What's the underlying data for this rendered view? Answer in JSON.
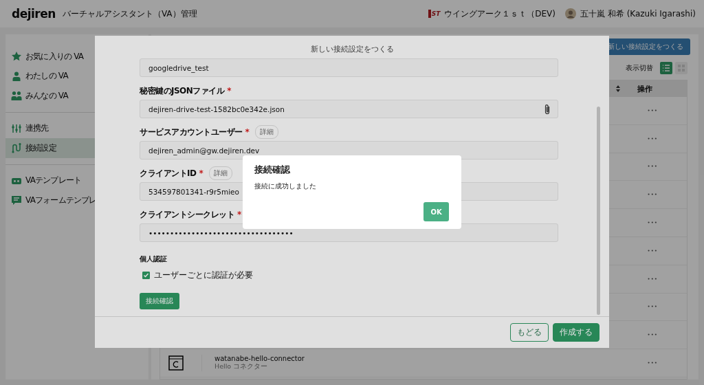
{
  "header": {
    "logo": "dejiren",
    "title": "バーチャルアシスタント（VA）管理",
    "org_logo": "ST",
    "org_name": "ウイングアーク１ｓｔ（DEV)",
    "user_name": "五十嵐 和希 (Kazuki Igarashi)"
  },
  "sidebar": {
    "groups": [
      {
        "items": [
          {
            "kind": "star",
            "label": "お気に入りの VA",
            "selected": false
          },
          {
            "kind": "person",
            "label": "わたしの VA",
            "selected": false
          },
          {
            "kind": "people",
            "label": "みんなの VA",
            "selected": false
          }
        ]
      },
      {
        "items": [
          {
            "kind": "sliders",
            "label": "連携先",
            "selected": false
          },
          {
            "kind": "route",
            "label": "接続設定",
            "selected": true
          }
        ]
      },
      {
        "items": [
          {
            "kind": "template",
            "label": "VAテンプレート",
            "selected": false
          },
          {
            "kind": "form",
            "label": "VAフォームテンプレ",
            "selected": false
          }
        ]
      }
    ]
  },
  "toolbar": {
    "new_button": "新しい接続設定をつくる",
    "view_label": "表示切替",
    "views": [
      {
        "kind": "list",
        "selected": true
      },
      {
        "kind": "grid",
        "selected": false
      }
    ]
  },
  "table": {
    "columns": [
      "操作"
    ],
    "rows": [
      {
        "operations": "•••"
      },
      {
        "operations": "•••"
      },
      {
        "operations": "•••"
      },
      {
        "operations": "•••"
      },
      {
        "operations": "•••"
      },
      {
        "operations": "•••"
      },
      {
        "operations": "•••"
      },
      {
        "operations": "•••"
      },
      {
        "operations": "•••"
      },
      {
        "name": "watanabe-hello-connector",
        "description": "Hello コネクター",
        "operations": "•••"
      }
    ]
  },
  "modal": {
    "title": "新しい接続設定をつくる",
    "first_value": "googledrive_test",
    "fields": [
      {
        "kind": "file",
        "label": "秘密鍵のJSONファイル",
        "required": "*",
        "value": "dejiren-drive-test-1582bc0e342e.json"
      },
      {
        "kind": "text",
        "label": "サービスアカウントユーザー",
        "required": "*",
        "detail": "詳細",
        "value": "dejiren_admin@gw.dejiren.dev"
      },
      {
        "kind": "text",
        "label": "クライアントID",
        "required": "*",
        "detail": "詳細",
        "value": "534597801341-r9r5mieo"
      },
      {
        "kind": "text",
        "label": "クライアントシークレット",
        "required": "*",
        "value": "••••••••••••••••••••••••••••••••••"
      }
    ],
    "section": "個人認証",
    "checkbox": {
      "label": "ユーザーごとに認証が必要",
      "checked": true
    },
    "test_button": "接続確認",
    "back_button": "もどる",
    "create_button": "作成する"
  },
  "alert": {
    "title": "接続確認",
    "message": "接続に成功しました",
    "ok": "OK"
  }
}
